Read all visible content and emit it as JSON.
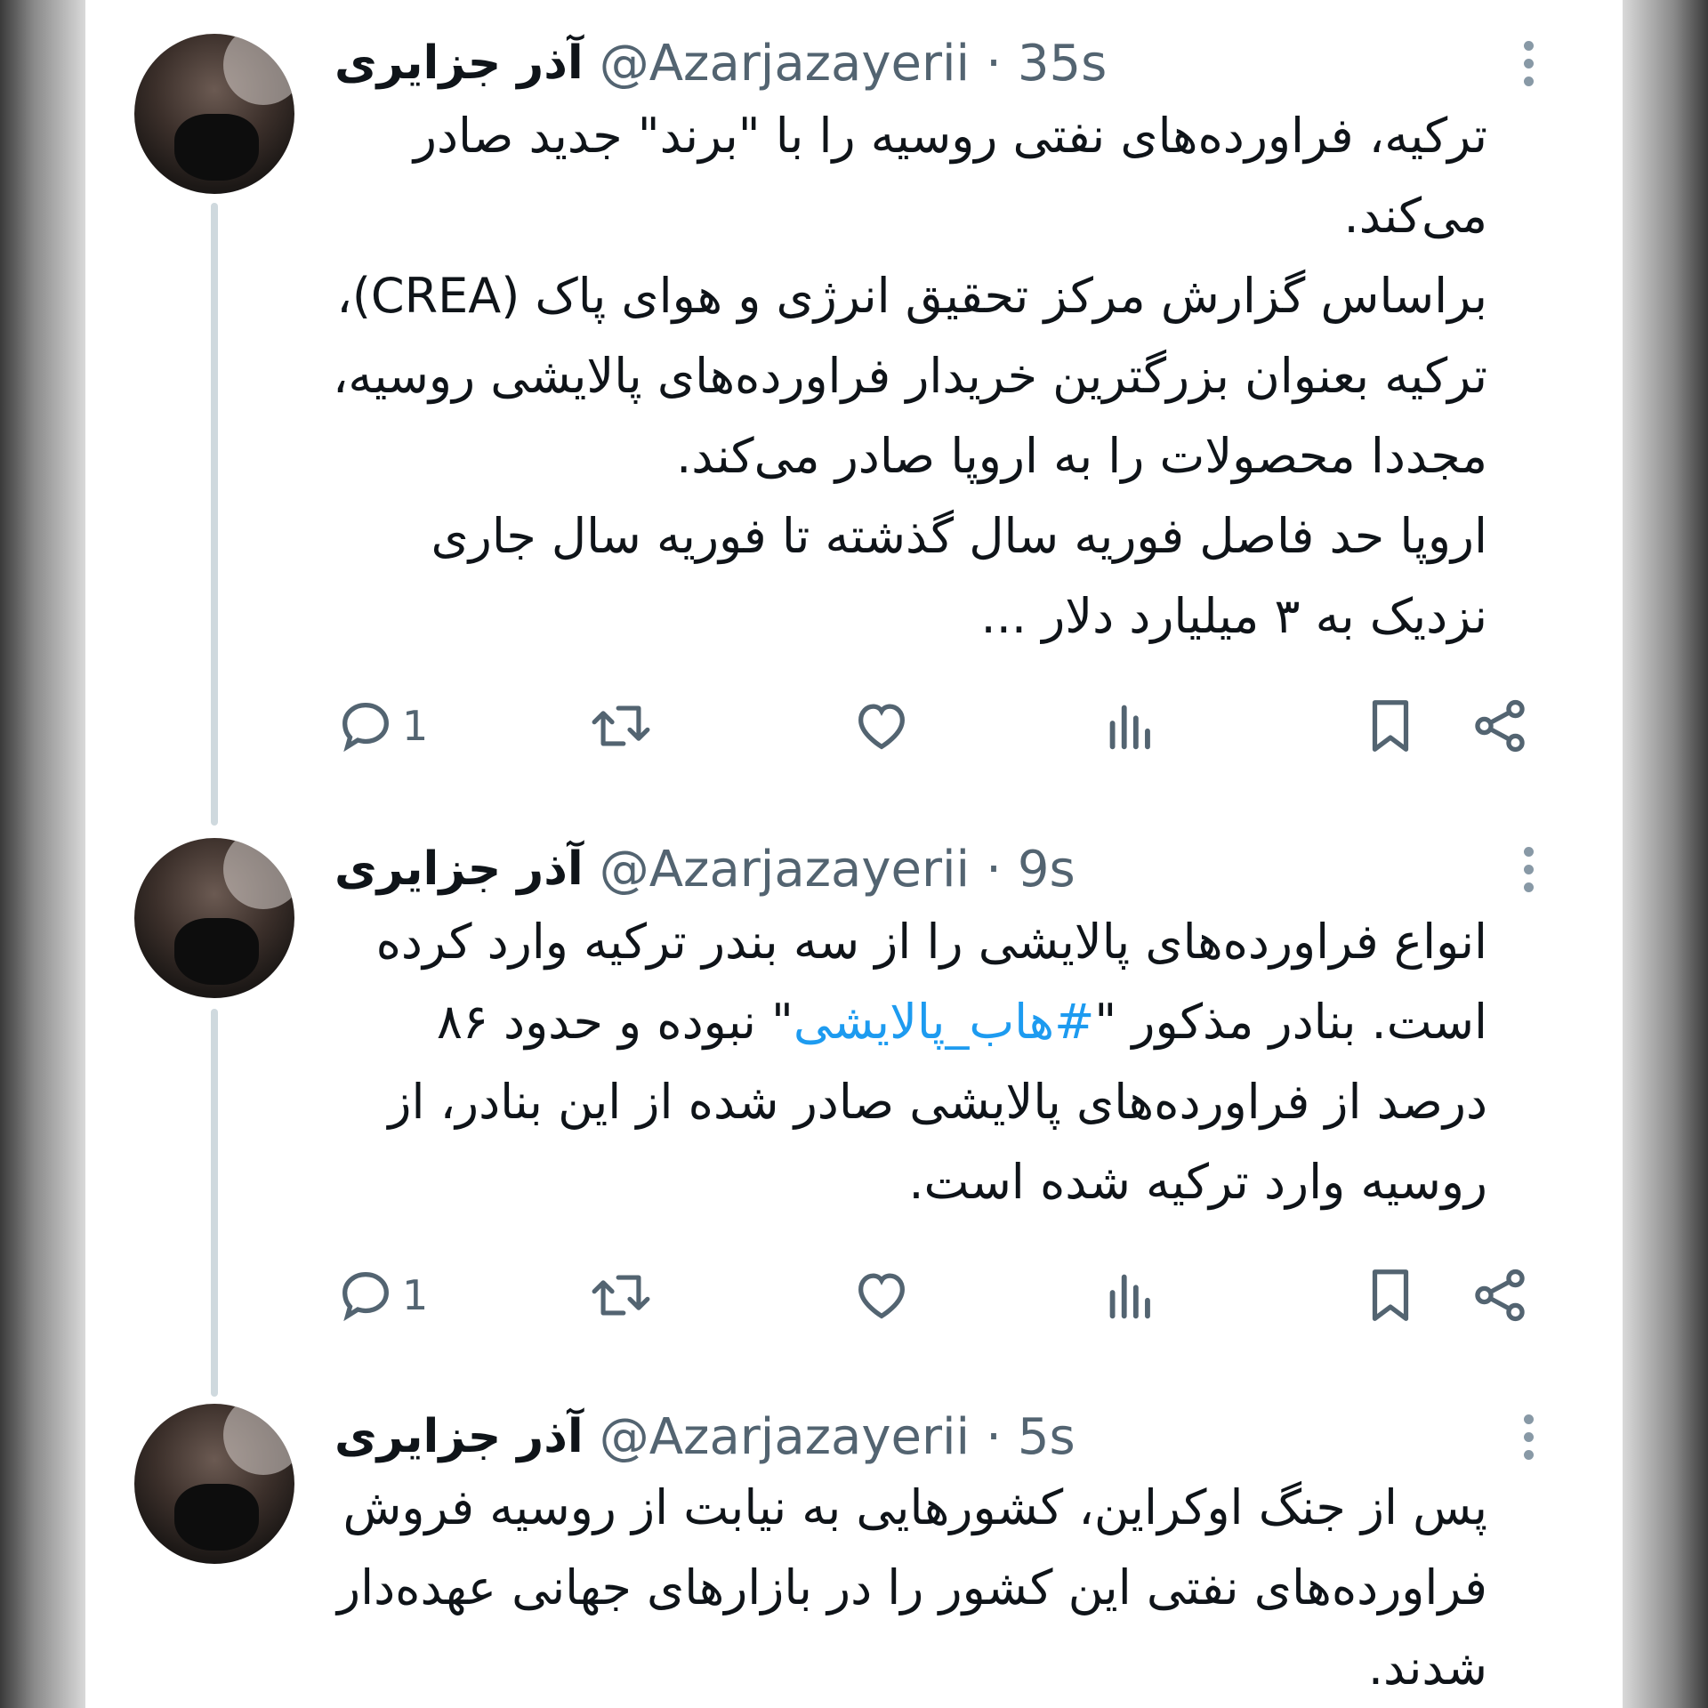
{
  "tweets": [
    {
      "display_name": "آذر جزایری",
      "handle": "@Azarjazayerii",
      "time": "35s",
      "lines": [
        "ترکیه، فراورده‌های نفتی روسیه را با \"برند\" جدید صادر",
        "می‌کند.",
        "براساس گزارش مرکز تحقیق انرژی و هوای پاک (CREA)،",
        "ترکیه بعنوان بزرگترین خریدار فراورده‌های پالایشی روسیه،",
        "مجددا محصولات را به اروپا صادر می‌کند.",
        "اروپا حد فاصل فوریه سال گذشته تا فوریه سال جاری",
        "نزدیک به ۳ میلیارد دلار ..."
      ],
      "reply_count": "1"
    },
    {
      "display_name": "آذر جزایری",
      "handle": "@Azarjazayerii",
      "time": "9s",
      "line1": "انواع فراورده‌های پالایشی را از سه بندر ترکیه وارد کرده",
      "line2_pre": "است. بنادر مذکور \"",
      "hashtag": "#هاب_پالایشی",
      "line2_post": "\" نبوده و حدود ۸۶",
      "line3": "درصد از فراورده‌های پالایشی صادر شده از این بنادر، از",
      "line4": "روسیه وارد ترکیه شده است.",
      "reply_count": "1"
    },
    {
      "display_name": "آذر جزایری",
      "handle": "@Azarjazayerii",
      "time": "5s",
      "lines": [
        "پس از جنگ اوکراین، کشورهایی به نیابت از روسیه فروش",
        "فراورده‌های نفتی این کشور را در بازارهای جهانی عهده‌دار",
        "شدند."
      ]
    }
  ],
  "separator": "·",
  "icons": [
    "reply-icon",
    "retweet-icon",
    "like-icon",
    "views-icon",
    "bookmark-icon",
    "share-icon",
    "more-icon"
  ],
  "colors": {
    "text": "#0f1419",
    "secondary": "#536471",
    "link": "#1d9bf0",
    "thread_line": "#cfd9de"
  }
}
